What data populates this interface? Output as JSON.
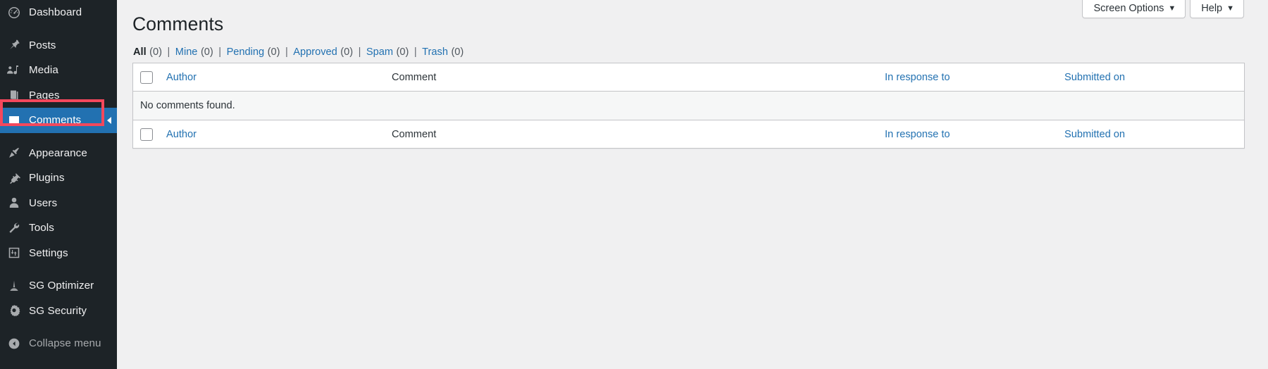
{
  "colors": {
    "sidebar_bg": "#1d2327",
    "accent_blue": "#2271b1",
    "highlight_red": "#f4485c",
    "page_bg": "#f0f0f1",
    "row_alt_bg": "#f6f7f7"
  },
  "sidebar": {
    "items": [
      {
        "label": "Dashboard",
        "icon": "dashboard-icon",
        "current": false,
        "group": 0
      },
      {
        "label": "Posts",
        "icon": "pin-icon",
        "current": false,
        "group": 1
      },
      {
        "label": "Media",
        "icon": "media-icon",
        "current": false,
        "group": 1
      },
      {
        "label": "Pages",
        "icon": "page-icon",
        "current": false,
        "group": 1
      },
      {
        "label": "Comments",
        "icon": "comment-bubble-icon",
        "current": true,
        "group": 1
      },
      {
        "label": "Appearance",
        "icon": "paintbrush-icon",
        "current": false,
        "group": 2
      },
      {
        "label": "Plugins",
        "icon": "plug-icon",
        "current": false,
        "group": 2
      },
      {
        "label": "Users",
        "icon": "user-icon",
        "current": false,
        "group": 2
      },
      {
        "label": "Tools",
        "icon": "wrench-icon",
        "current": false,
        "group": 2
      },
      {
        "label": "Settings",
        "icon": "sliders-icon",
        "current": false,
        "group": 2
      },
      {
        "label": "SG Optimizer",
        "icon": "sg-optimizer-icon",
        "current": false,
        "group": 3
      },
      {
        "label": "SG Security",
        "icon": "sg-security-shield-icon",
        "current": false,
        "group": 3
      }
    ],
    "collapse": {
      "label": "Collapse menu",
      "icon": "collapse-arrow-icon"
    }
  },
  "screen_meta": {
    "screen_options_label": "Screen Options",
    "help_label": "Help",
    "arrow_glyph": "▼"
  },
  "main": {
    "page_title": "Comments",
    "filter_divider": "|",
    "filters": [
      {
        "label": "All",
        "count": "(0)",
        "current": true
      },
      {
        "label": "Mine",
        "count": "(0)",
        "current": false
      },
      {
        "label": "Pending",
        "count": "(0)",
        "current": false
      },
      {
        "label": "Approved",
        "count": "(0)",
        "current": false
      },
      {
        "label": "Spam",
        "count": "(0)",
        "current": false
      },
      {
        "label": "Trash",
        "count": "(0)",
        "current": false
      }
    ],
    "table": {
      "columns": {
        "author": "Author",
        "comment": "Comment",
        "response": "In response to",
        "date": "Submitted on"
      },
      "empty_message": "No comments found.",
      "rows": []
    }
  }
}
